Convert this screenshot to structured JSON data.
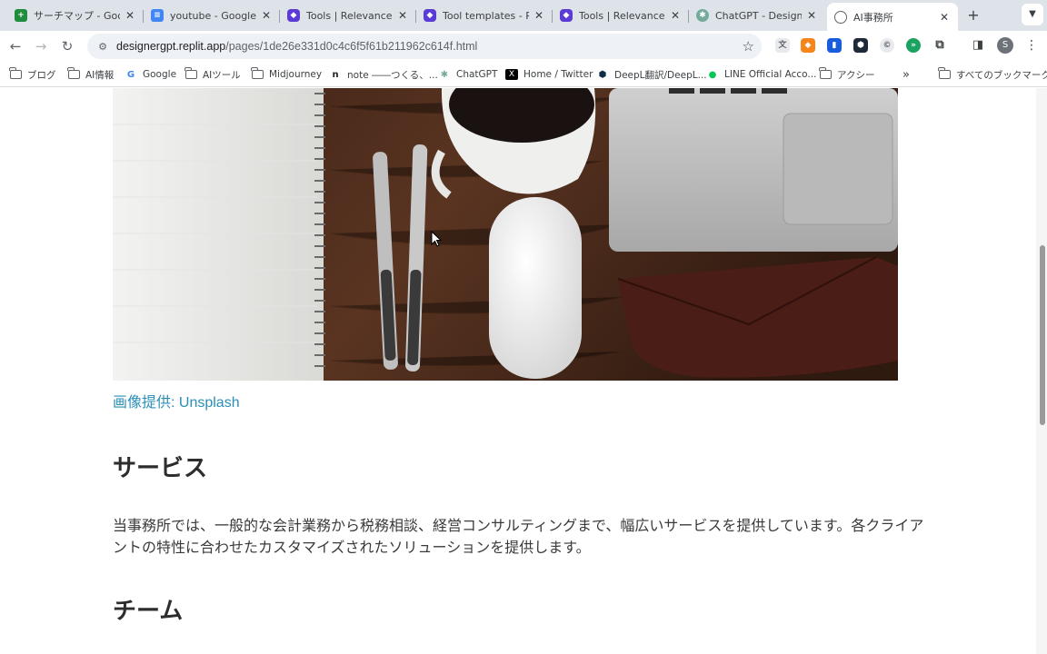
{
  "tabs": [
    {
      "title": "サーチマップ - Google",
      "favicon": "sheets-icon",
      "color": "#1e8e3e"
    },
    {
      "title": "youtube - Google ド",
      "favicon": "docs-icon",
      "color": "#4285f4"
    },
    {
      "title": "Tools | Relevance AI",
      "favicon": "relevance-icon",
      "color": "#5b3bd6"
    },
    {
      "title": "Tool templates - Rele",
      "favicon": "relevance-icon",
      "color": "#5b3bd6"
    },
    {
      "title": "Tools | Relevance AI",
      "favicon": "relevance-icon",
      "color": "#5b3bd6"
    },
    {
      "title": "ChatGPT - Designer",
      "favicon": "chatgpt-icon",
      "color": "#74aa9c"
    },
    {
      "title": "AI事務所",
      "favicon": "globe-icon",
      "color": "#5f6368",
      "active": true
    }
  ],
  "toolbar": {
    "url_host": "designergpt.replit.app",
    "url_path": "/pages/1de26e331d0c4c6f5f61b211962c614f.html",
    "profile_initial": "S"
  },
  "bookmarks": [
    {
      "label": "ブログ",
      "icon": "folder-icon"
    },
    {
      "label": "AI情報",
      "icon": "folder-icon"
    },
    {
      "label": "Google",
      "icon": "google-icon"
    },
    {
      "label": "AIツール",
      "icon": "folder-icon"
    },
    {
      "label": "Midjourney",
      "icon": "folder-icon"
    },
    {
      "label": "note ――つくる、...",
      "icon": "note-icon"
    },
    {
      "label": "ChatGPT",
      "icon": "chatgpt-icon"
    },
    {
      "label": "Home / Twitter",
      "icon": "x-icon"
    },
    {
      "label": "DeepL翻訳/DeepL...",
      "icon": "deepl-icon"
    },
    {
      "label": "LINE Official Acco...",
      "icon": "line-icon"
    },
    {
      "label": "アクシー",
      "icon": "folder-icon"
    }
  ],
  "bookmarks_all": "すべてのブックマーク",
  "page": {
    "caption": "画像提供: Unsplash",
    "services_heading": "サービス",
    "services_text": "当事務所では、一般的な会計業務から税務相談、経営コンサルティングまで、幅広いサービスを提供しています。各クライアントの特性に合わせたカスタマイズされたソリューションを提供します。",
    "team_heading": "チーム"
  },
  "colors": {
    "link": "#2a8fb5",
    "heading": "#2d2d2d",
    "tabstrip_bg": "#dee3ea"
  }
}
